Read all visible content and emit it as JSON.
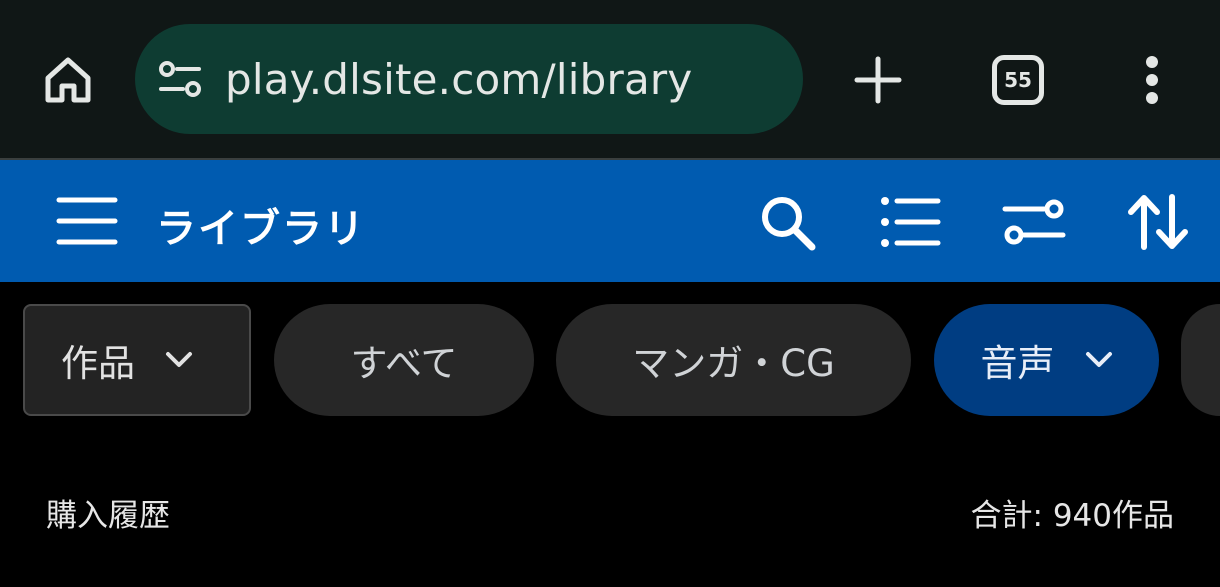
{
  "browser": {
    "url": "play.dlsite.com/library",
    "tab_count": "55",
    "icons": [
      "home-icon",
      "site-info-icon",
      "plus-icon",
      "tab-switcher-icon",
      "more-vert-icon"
    ]
  },
  "header": {
    "title": "ライブラリ",
    "background_color": "#005bb0",
    "icons": [
      "menu-icon",
      "search-icon",
      "list-view-icon",
      "filter-icon",
      "sort-icon"
    ]
  },
  "filters": {
    "select_label": "作品",
    "chips": [
      {
        "label": "すべて",
        "active": false
      },
      {
        "label": "マンガ・CG",
        "active": false
      },
      {
        "label": "音声",
        "active": true
      }
    ],
    "active_color": "#003d82"
  },
  "summary": {
    "section_label": "購入履歴",
    "total": "合計: 940作品"
  }
}
